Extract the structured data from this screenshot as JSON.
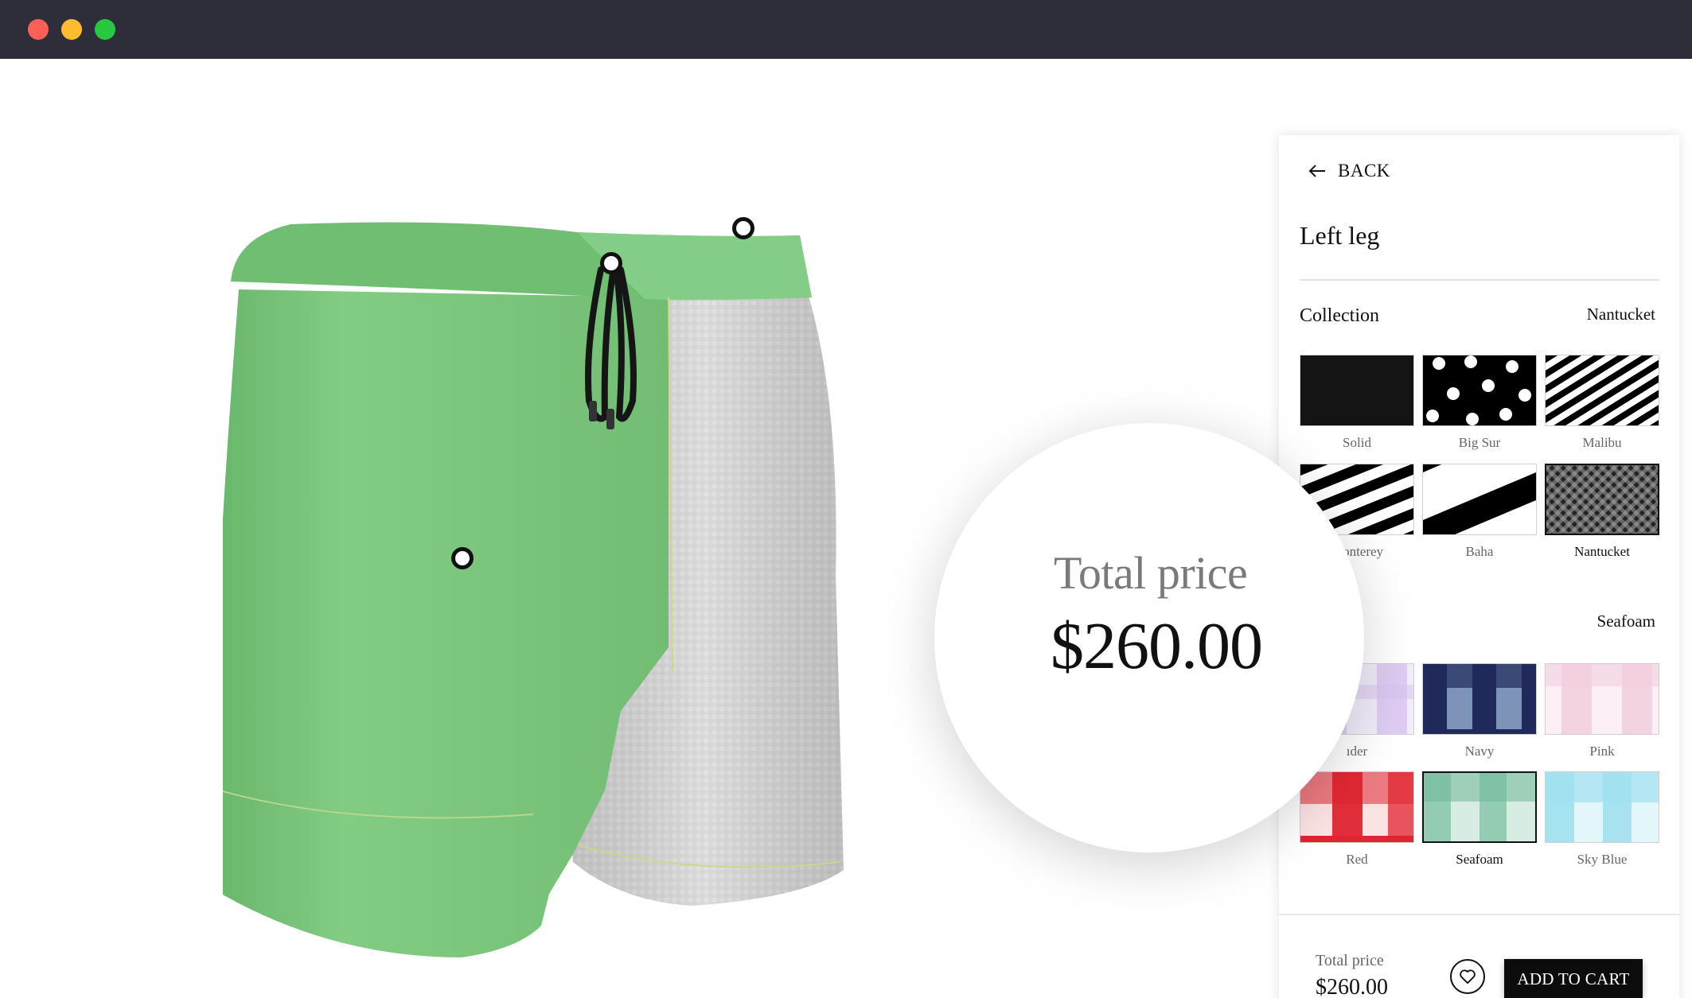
{
  "window": {
    "controls": [
      "close",
      "minimize",
      "maximize"
    ]
  },
  "magnifier": {
    "label": "Total price",
    "value": "$260.00"
  },
  "panel": {
    "back_label": "BACK",
    "title": "Left leg",
    "collection": {
      "label": "Collection",
      "selected": "Nantucket"
    },
    "patterns": [
      {
        "name": "Solid",
        "selected": false
      },
      {
        "name": "Big Sur",
        "selected": false
      },
      {
        "name": "Malibu",
        "selected": false
      },
      {
        "name": "Monterey",
        "selected": false
      },
      {
        "name": "Baha",
        "selected": false
      },
      {
        "name": "Nantucket",
        "selected": true
      }
    ],
    "color": {
      "selected": "Seafoam"
    },
    "colors": [
      {
        "name": "Lavender",
        "visible_name": "ıder",
        "hex": "#d8c4f0",
        "selected": false
      },
      {
        "name": "Navy",
        "hex": "#1f2a5a",
        "selected": false
      },
      {
        "name": "Pink",
        "hex": "#f2cfe0",
        "selected": false
      },
      {
        "name": "Red",
        "hex": "#e02430",
        "selected": false
      },
      {
        "name": "Seafoam",
        "hex": "#8cc9ae",
        "selected": true
      },
      {
        "name": "Sky Blue",
        "hex": "#9fe0ef",
        "selected": false
      }
    ],
    "footer": {
      "total_label": "Total price",
      "total_value": "$260.00",
      "favorite_icon": "heart-icon",
      "add_to_cart_label": "ADD TO CART"
    }
  },
  "product": {
    "colors": {
      "left": "#78c57a",
      "right": "#d9d9d9",
      "drawcord": "#151515"
    }
  }
}
